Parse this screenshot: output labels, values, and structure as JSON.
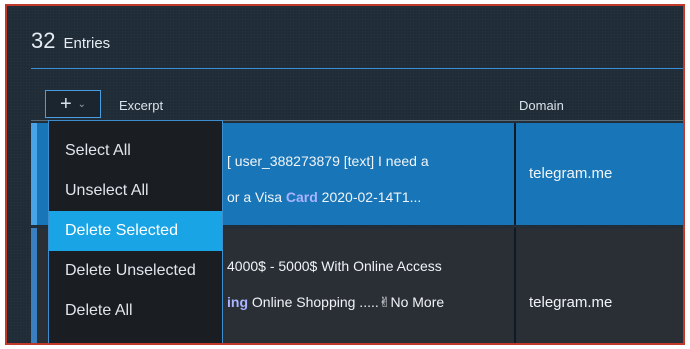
{
  "header": {
    "count": "32",
    "label": "Entries"
  },
  "toolbar": {
    "add_symbol": "+",
    "chevron": "⌄"
  },
  "columns": {
    "excerpt": "Excerpt",
    "domain": "Domain"
  },
  "rows": [
    {
      "excerpt_line1": "[ user_388273879 [text] I need a",
      "excerpt_line2_pre": "or a Visa ",
      "excerpt_line2_hl": "Card",
      "excerpt_line2_post": " 2020-02-14T1...",
      "domain": "telegram.me"
    },
    {
      "excerpt_line1": "4000$ - 5000$ With Online Access",
      "excerpt_line2_hl": "ing",
      "excerpt_line2_post": " Online Shopping .....✌No More",
      "domain": "telegram.me"
    }
  ],
  "menu": {
    "items": [
      "Select All",
      "Unselect All",
      "Delete Selected",
      "Delete Unselected",
      "Delete All"
    ],
    "active_index": 2
  },
  "colors": {
    "accent": "#19a4e6",
    "selected_row": "#1875b8",
    "border": "#c0392b"
  }
}
